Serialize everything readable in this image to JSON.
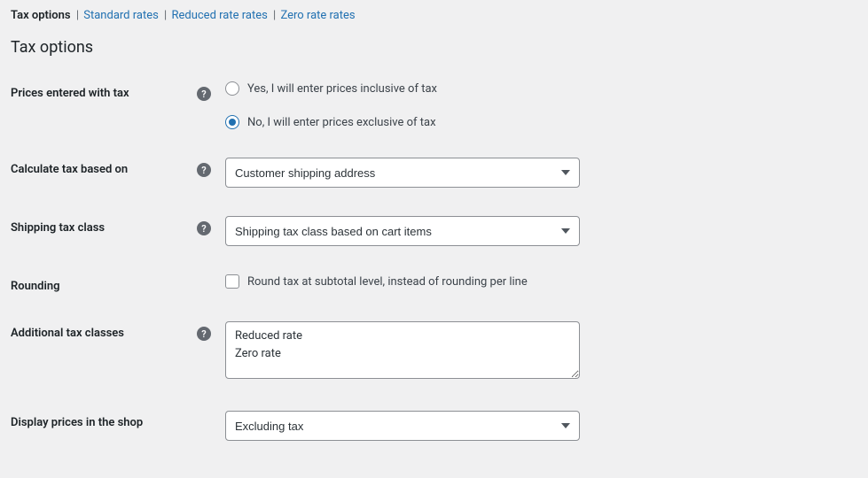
{
  "subnav": {
    "active": "Tax options",
    "links": [
      "Standard rates",
      "Reduced rate rates",
      "Zero rate rates"
    ]
  },
  "heading": "Tax options",
  "fields": {
    "prices_with_tax": {
      "label": "Prices entered with tax",
      "option_yes": "Yes, I will enter prices inclusive of tax",
      "option_no": "No, I will enter prices exclusive of tax"
    },
    "calculate_tax": {
      "label": "Calculate tax based on",
      "value": "Customer shipping address"
    },
    "shipping_tax_class": {
      "label": "Shipping tax class",
      "value": "Shipping tax class based on cart items"
    },
    "rounding": {
      "label": "Rounding",
      "checkbox_label": "Round tax at subtotal level, instead of rounding per line"
    },
    "additional_classes": {
      "label": "Additional tax classes",
      "value": "Reduced rate\nZero rate"
    },
    "display_shop": {
      "label": "Display prices in the shop",
      "value": "Excluding tax"
    }
  }
}
